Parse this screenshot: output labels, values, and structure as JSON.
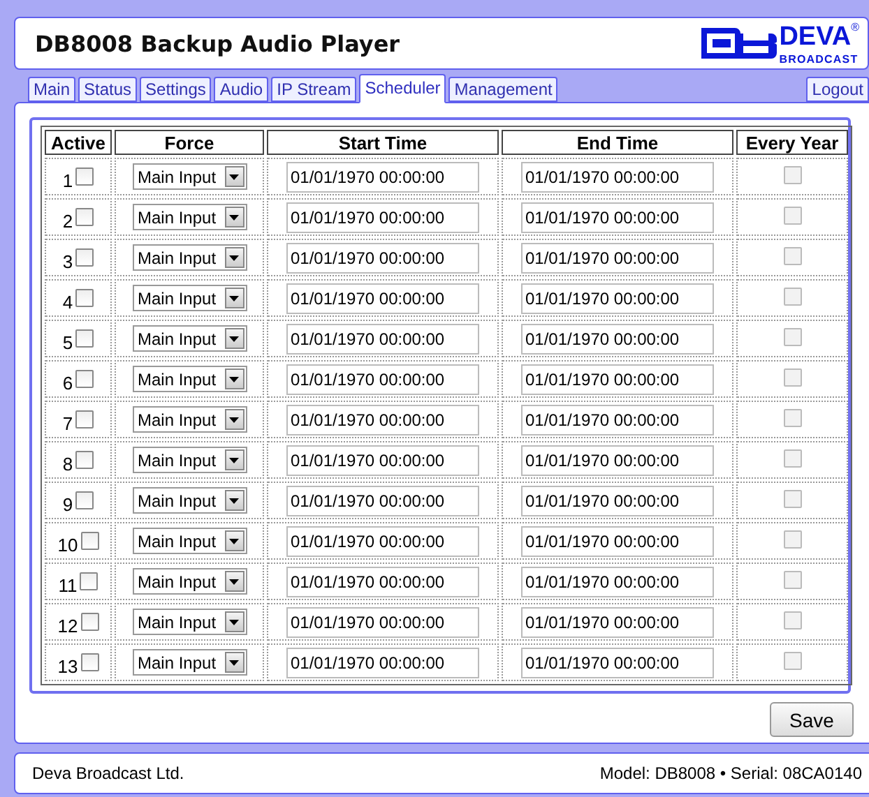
{
  "header": {
    "title": "DB8008 Backup Audio Player",
    "logo": {
      "name": "DEVA",
      "mark": "®",
      "tagline": "BROADCAST"
    }
  },
  "tabs": [
    {
      "label": "Main",
      "selected": false
    },
    {
      "label": "Status",
      "selected": false
    },
    {
      "label": "Settings",
      "selected": false
    },
    {
      "label": "Audio",
      "selected": false
    },
    {
      "label": "IP Stream",
      "selected": false
    },
    {
      "label": "Scheduler",
      "selected": true
    },
    {
      "label": "Management",
      "selected": false
    }
  ],
  "logout": "Logout",
  "table": {
    "columns": [
      "Active",
      "Force",
      "Start Time",
      "End Time",
      "Every Year"
    ],
    "rows": [
      {
        "number": "1",
        "active": false,
        "force": "Main Input",
        "start_time": "01/01/1970 00:00:00",
        "end_time": "01/01/1970 00:00:00",
        "every_year": false,
        "every_year_disabled": true
      },
      {
        "number": "2",
        "active": false,
        "force": "Main Input",
        "start_time": "01/01/1970 00:00:00",
        "end_time": "01/01/1970 00:00:00",
        "every_year": false,
        "every_year_disabled": true
      },
      {
        "number": "3",
        "active": false,
        "force": "Main Input",
        "start_time": "01/01/1970 00:00:00",
        "end_time": "01/01/1970 00:00:00",
        "every_year": false,
        "every_year_disabled": true
      },
      {
        "number": "4",
        "active": false,
        "force": "Main Input",
        "start_time": "01/01/1970 00:00:00",
        "end_time": "01/01/1970 00:00:00",
        "every_year": false,
        "every_year_disabled": true
      },
      {
        "number": "5",
        "active": false,
        "force": "Main Input",
        "start_time": "01/01/1970 00:00:00",
        "end_time": "01/01/1970 00:00:00",
        "every_year": false,
        "every_year_disabled": true
      },
      {
        "number": "6",
        "active": false,
        "force": "Main Input",
        "start_time": "01/01/1970 00:00:00",
        "end_time": "01/01/1970 00:00:00",
        "every_year": false,
        "every_year_disabled": true
      },
      {
        "number": "7",
        "active": false,
        "force": "Main Input",
        "start_time": "01/01/1970 00:00:00",
        "end_time": "01/01/1970 00:00:00",
        "every_year": false,
        "every_year_disabled": true
      },
      {
        "number": "8",
        "active": false,
        "force": "Main Input",
        "start_time": "01/01/1970 00:00:00",
        "end_time": "01/01/1970 00:00:00",
        "every_year": false,
        "every_year_disabled": true
      },
      {
        "number": "9",
        "active": false,
        "force": "Main Input",
        "start_time": "01/01/1970 00:00:00",
        "end_time": "01/01/1970 00:00:00",
        "every_year": false,
        "every_year_disabled": true
      },
      {
        "number": "10",
        "active": false,
        "force": "Main Input",
        "start_time": "01/01/1970 00:00:00",
        "end_time": "01/01/1970 00:00:00",
        "every_year": false,
        "every_year_disabled": true
      },
      {
        "number": "11",
        "active": false,
        "force": "Main Input",
        "start_time": "01/01/1970 00:00:00",
        "end_time": "01/01/1970 00:00:00",
        "every_year": false,
        "every_year_disabled": true
      },
      {
        "number": "12",
        "active": false,
        "force": "Main Input",
        "start_time": "01/01/1970 00:00:00",
        "end_time": "01/01/1970 00:00:00",
        "every_year": false,
        "every_year_disabled": true
      },
      {
        "number": "13",
        "active": false,
        "force": "Main Input",
        "start_time": "01/01/1970 00:00:00",
        "end_time": "01/01/1970 00:00:00",
        "every_year": false,
        "every_year_disabled": true
      }
    ]
  },
  "save": "Save",
  "footer": {
    "company": "Deva Broadcast Ltd.",
    "device": "Model: DB8008 • Serial: 08CA0140"
  }
}
